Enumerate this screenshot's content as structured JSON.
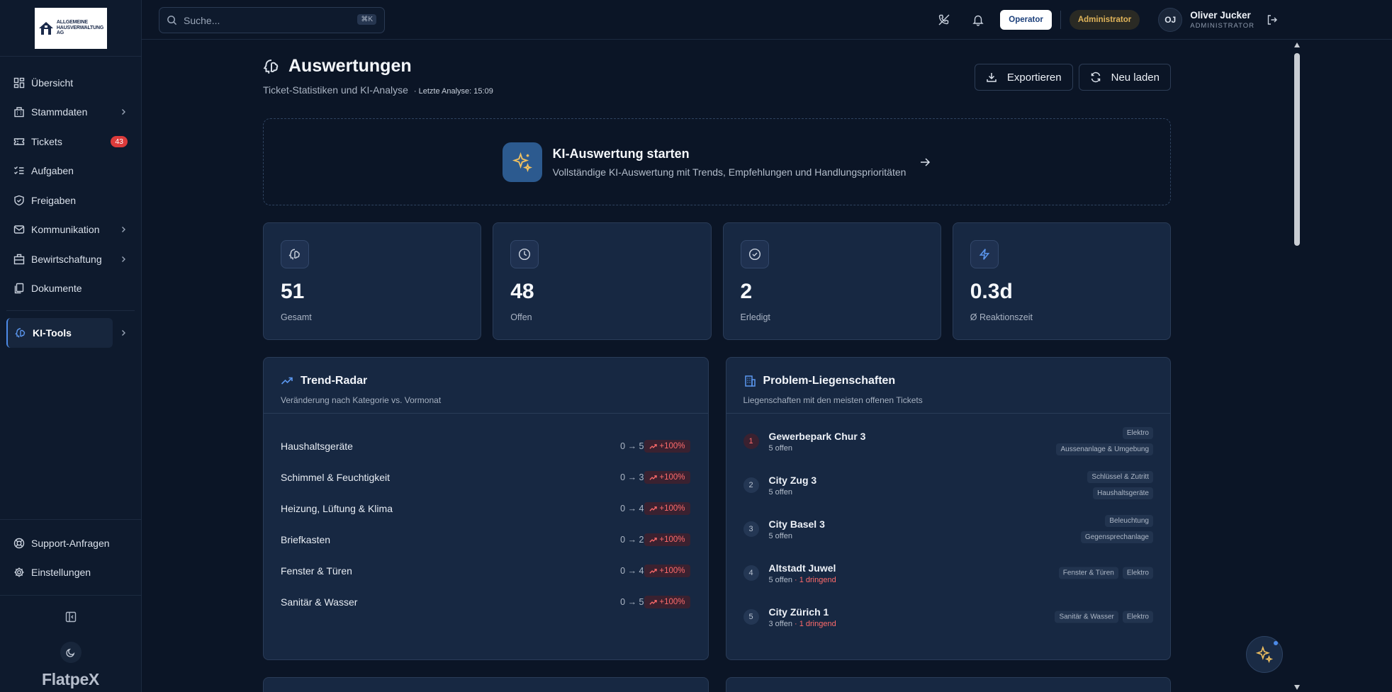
{
  "logo": {
    "line1": "ALLGEMEINE",
    "line2": "HAUSVERWALTUNG",
    "line3": "AG"
  },
  "brand": "FlatpeX",
  "search": {
    "placeholder": "Suche...",
    "shortcut": "⌘K"
  },
  "topbar": {
    "operator_label": "Operator",
    "admin_label": "Administrator",
    "user_initials": "OJ",
    "user_name": "Oliver Jucker",
    "user_role": "ADMINISTRATOR"
  },
  "sidebar": {
    "items": [
      {
        "label": "Übersicht",
        "icon": "grid-icon"
      },
      {
        "label": "Stammdaten",
        "icon": "building-icon",
        "chevron": true
      },
      {
        "label": "Tickets",
        "icon": "ticket-icon",
        "badge": "43"
      },
      {
        "label": "Aufgaben",
        "icon": "list-check-icon"
      },
      {
        "label": "Freigaben",
        "icon": "shield-check-icon"
      },
      {
        "label": "Kommunikation",
        "icon": "mail-icon",
        "chevron": true
      },
      {
        "label": "Bewirtschaftung",
        "icon": "office-icon",
        "chevron": true
      },
      {
        "label": "Dokumente",
        "icon": "documents-icon"
      }
    ],
    "active_item": {
      "label": "KI-Tools",
      "icon": "brain-icon"
    },
    "bottom_items": [
      {
        "label": "Support-Anfragen",
        "icon": "lifebuoy-icon"
      },
      {
        "label": "Einstellungen",
        "icon": "gear-icon"
      }
    ]
  },
  "page": {
    "title": "Auswertungen",
    "subtitle": "Ticket-Statistiken und KI-Analyse",
    "last_analysis": "· Letzte Analyse: 15:09",
    "export_label": "Exportieren",
    "reload_label": "Neu laden"
  },
  "ki_cta": {
    "title": "KI-Auswertung starten",
    "description": "Vollständige KI-Auswertung mit Trends, Empfehlungen und Handlungsprioritäten"
  },
  "stats": [
    {
      "value": "51",
      "label": "Gesamt",
      "icon": "brain-icon"
    },
    {
      "value": "48",
      "label": "Offen",
      "icon": "clock-icon"
    },
    {
      "value": "2",
      "label": "Erledigt",
      "icon": "check-circle-icon"
    },
    {
      "value": "0.3d",
      "label": "Ø Reaktionszeit",
      "icon": "lightning-icon"
    }
  ],
  "trend_radar": {
    "title": "Trend-Radar",
    "subtitle": "Veränderung nach Kategorie vs. Vormonat",
    "rows": [
      {
        "name": "Haushaltsgeräte",
        "change": "0 → 5",
        "pct": "+100%"
      },
      {
        "name": "Schimmel & Feuchtigkeit",
        "change": "0 → 3",
        "pct": "+100%"
      },
      {
        "name": "Heizung, Lüftung & Klima",
        "change": "0 → 4",
        "pct": "+100%"
      },
      {
        "name": "Briefkasten",
        "change": "0 → 2",
        "pct": "+100%"
      },
      {
        "name": "Fenster & Türen",
        "change": "0 → 4",
        "pct": "+100%"
      },
      {
        "name": "Sanitär & Wasser",
        "change": "0 → 5",
        "pct": "+100%"
      }
    ]
  },
  "problem_properties": {
    "title": "Problem-Liegenschaften",
    "subtitle": "Liegenschaften mit den meisten offenen Tickets",
    "rows": [
      {
        "rank": "1",
        "name": "Gewerbepark Chur 3",
        "open": "5 offen",
        "urgent": "",
        "tags": [
          "Elektro",
          "Aussenanlage & Umgebung"
        ]
      },
      {
        "rank": "2",
        "name": "City Zug 3",
        "open": "5 offen",
        "urgent": "",
        "tags": [
          "Schlüssel & Zutritt",
          "Haushaltsgeräte"
        ]
      },
      {
        "rank": "3",
        "name": "City Basel 3",
        "open": "5 offen",
        "urgent": "",
        "tags": [
          "Beleuchtung",
          "Gegensprechanlage"
        ]
      },
      {
        "rank": "4",
        "name": "Altstadt Juwel",
        "open": "5 offen",
        "urgent": " · 1 dringend",
        "tags": [
          "Fenster & Türen",
          "Elektro"
        ]
      },
      {
        "rank": "5",
        "name": "City Zürich 1",
        "open": "3 offen",
        "urgent": " · 1 dringend",
        "tags": [
          "Sanitär & Wasser",
          "Elektro"
        ]
      }
    ]
  },
  "colors": {
    "accent": "#4d8be8",
    "danger": "#ff6b6b",
    "admin": "#e0b45a",
    "panel": "#172842"
  }
}
